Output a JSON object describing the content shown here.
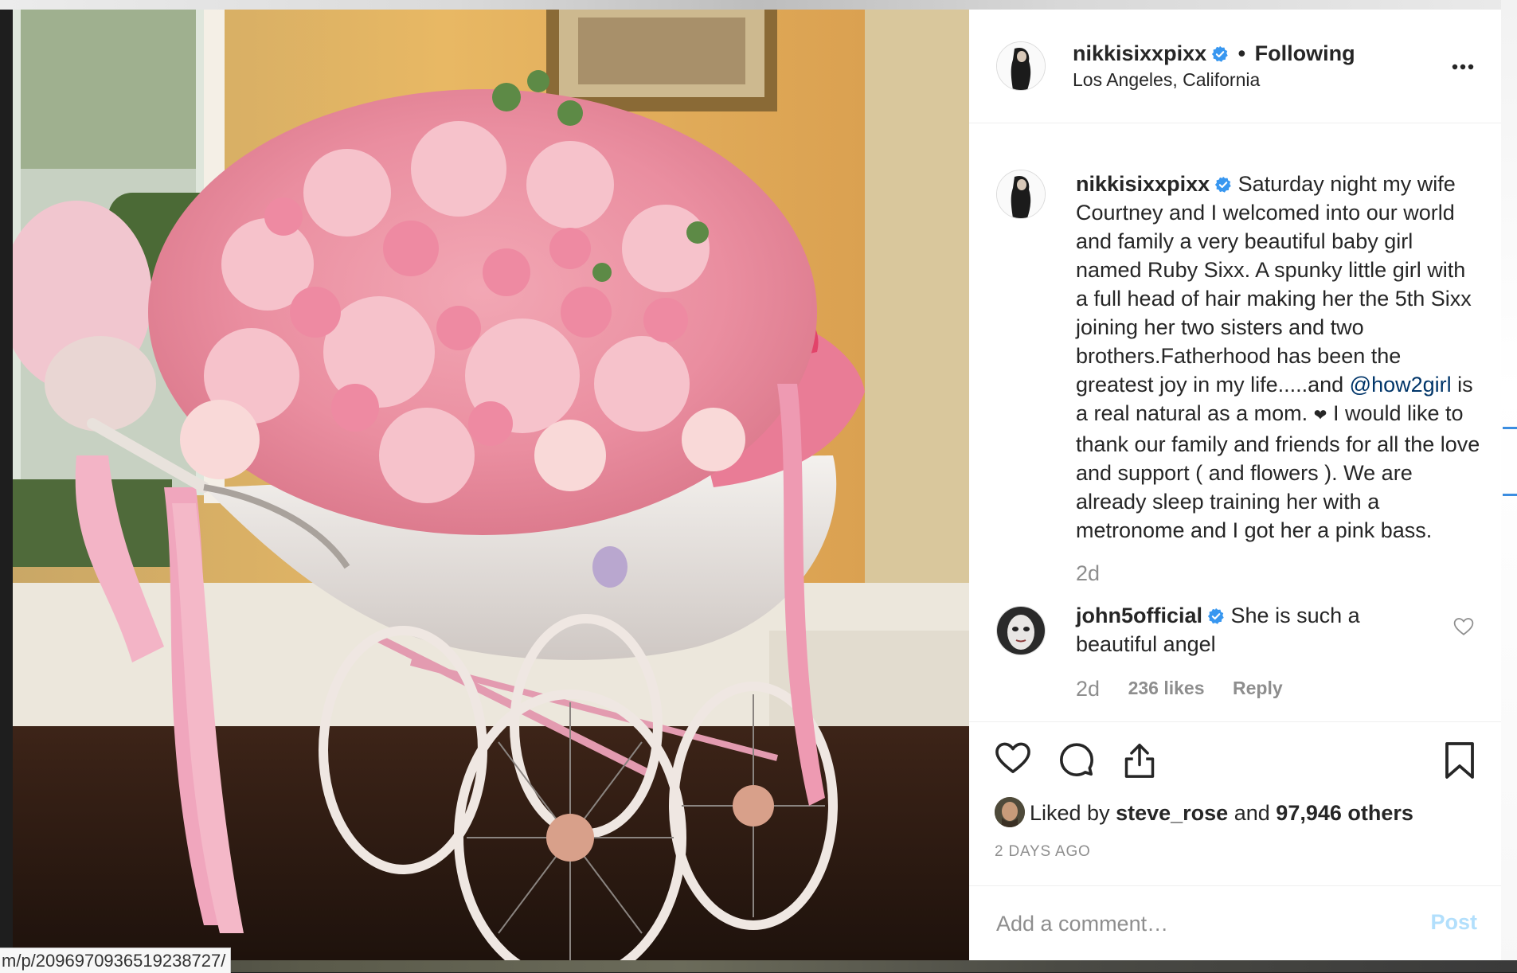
{
  "post": {
    "author": "nikkisixxpixx",
    "separator": "•",
    "follow_status": "Following",
    "location": "Los Angeles, California",
    "caption_before_mention": "Saturday night my wife Courtney and I welcomed into our world and family a very beautiful baby girl named Ruby Sixx. A spunky little girl with a full head of hair making her the 5th Sixx joining her two sisters and two brothers.Fatherhood has been the greatest joy in my life.....and",
    "mention": "@how2girl",
    "caption_mid": "is a real natural as a mom.",
    "heart": "❤",
    "caption_after": "I would like to thank our family and friends for all the love and support ( and flowers ). We are already sleep training her with a metronome and I got her a pink bass.",
    "caption_time": "2d",
    "photo_alt": "Vintage pink baby pram overflowing with pink roses, peonies and hydrangeas"
  },
  "comment": {
    "author": "john5official",
    "text": "She is such a beautiful angel",
    "time": "2d",
    "likes": "236 likes",
    "reply_label": "Reply"
  },
  "likes": {
    "prefix": "Liked by",
    "user": "steve_rose",
    "middle": "and",
    "count": "97,946 others"
  },
  "post_date": "2 DAYS AGO",
  "comment_box": {
    "placeholder": "Add a comment…",
    "post_label": "Post"
  },
  "status_url": "m/p/2096970936519238727/",
  "icons": {
    "verified": "verified-badge-icon",
    "more": "more-options-icon",
    "like": "heart-icon",
    "comment": "comment-icon",
    "share": "share-icon",
    "save": "bookmark-icon"
  },
  "colors": {
    "verified": "#3897f0",
    "mention": "#003569",
    "muted": "#8e8e8e",
    "post_disabled": "#b2dffc",
    "text": "#262626"
  }
}
